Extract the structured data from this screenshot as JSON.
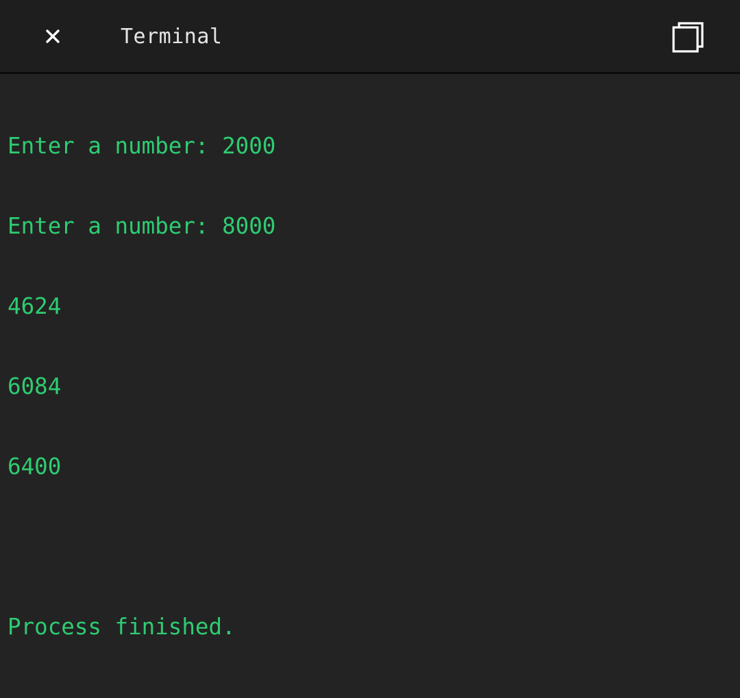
{
  "header": {
    "title": "Terminal",
    "close_icon": "close-icon",
    "copy_icon": "copy-icon"
  },
  "terminal": {
    "lines": [
      "Enter a number: 2000",
      "Enter a number: 8000",
      "4624",
      "6084",
      "6400",
      "",
      "Process finished."
    ]
  },
  "colors": {
    "background": "#232323",
    "header_background": "#1e1e1e",
    "output_text": "#2ecc71",
    "title_text": "#e6e6e6"
  }
}
